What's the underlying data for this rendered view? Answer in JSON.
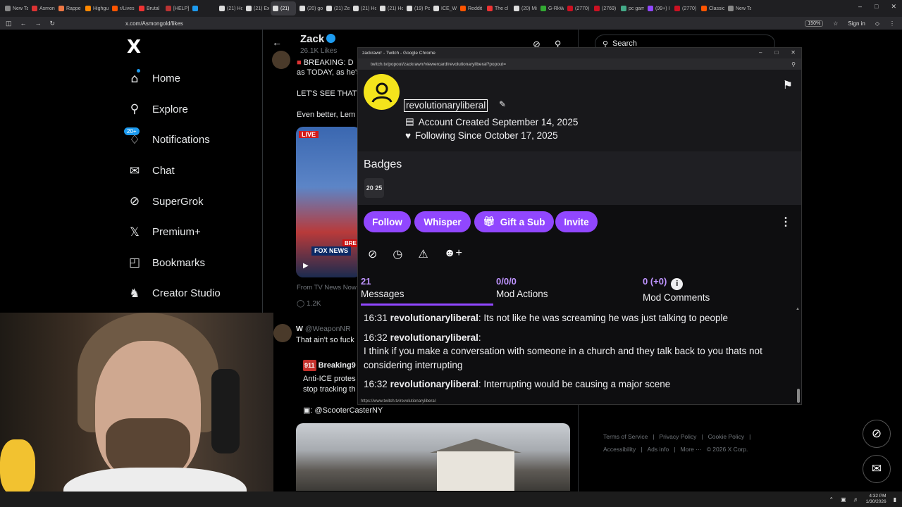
{
  "browser": {
    "tabs": [
      "New Tab",
      "Asmon",
      "Rappe",
      "Highgu",
      "r/Lives",
      "Brutal",
      "[HELP]",
      "",
      "(21) Ho",
      "(21) Ex",
      "(21)",
      "(20) go",
      "(21) Ze",
      "(21) Ho",
      "(21) Ho",
      "(19) Po",
      "ICE_Wi",
      "Reddit",
      "The cl",
      "(20) Mi",
      "G-RkWi",
      "(2770)",
      "(2769)",
      "pc gam",
      "(99+) I",
      "(2770)",
      "Classic",
      "New Ta"
    ],
    "url": "x.com/Asmongold/likes",
    "zoom": "150%",
    "sign_in": "Sign in"
  },
  "x_sidebar": {
    "logo": "X",
    "items": [
      {
        "label": "Home",
        "icon": "home-icon"
      },
      {
        "label": "Explore",
        "icon": "search-icon"
      },
      {
        "label": "Notifications",
        "icon": "bell-icon",
        "badge": "20+"
      },
      {
        "label": "Chat",
        "icon": "mail-icon"
      },
      {
        "label": "SuperGrok",
        "icon": "grok-icon"
      },
      {
        "label": "Premium+",
        "icon": "x-icon"
      },
      {
        "label": "Bookmarks",
        "icon": "bookmark-icon"
      },
      {
        "label": "Creator Studio",
        "icon": "creator-icon"
      }
    ]
  },
  "timeline": {
    "profile_name": "Zack",
    "likes": "26.1K Likes",
    "tweet1": {
      "line1": "BREAKING: D",
      "line2": "as TODAY, as he's",
      "line3": "LET'S SEE THAT I",
      "line4": "Even better, Lem",
      "live": "LIVE",
      "bre": "BRE",
      "fox": "FOX NEWS",
      "source": "From TV News Now",
      "replies": "1.2K"
    },
    "tweet2": {
      "author": "W",
      "handle": "@WeaponNR",
      "text": "That ain't so fuck",
      "quoted_name": "Breaking9",
      "quoted_line1": "Anti-ICE protes",
      "quoted_line2": "stop tracking th",
      "credit": ": @ScooterCasterNY",
      "badge911": "911"
    }
  },
  "right_column": {
    "search_placeholder": "Search",
    "footer": [
      "Terms of Service",
      "|",
      "Privacy Policy",
      "|",
      "Cookie Policy",
      "|",
      "Accessibility",
      "|",
      "Ads info",
      "|",
      "More ···",
      "© 2026 X Corp."
    ]
  },
  "popup": {
    "window_title": "zackrawrr - Twitch - Google Chrome",
    "url": "twitch.tv/popout/zackrawrr/viewercard/revolutionaryliberal?popout=",
    "username": "revolutionaryliberal",
    "account_created": "Account Created September 14, 2025",
    "following_since": "Following Since October 17, 2025",
    "badges_title": "Badges",
    "badge_text": "20 25",
    "buttons": {
      "follow": "Follow",
      "whisper": "Whisper",
      "gift": "Gift a Sub",
      "invite": "Invite"
    },
    "stats": {
      "messages_num": "21",
      "messages_lbl": "Messages",
      "mod_actions_num": "0/0/0",
      "mod_actions_lbl": "Mod Actions",
      "mod_comments_num": "0 (+0)",
      "mod_comments_lbl": "Mod Comments"
    },
    "chat": [
      {
        "time": "16:31",
        "name": "revolutionaryliberal",
        "text": "Its not like he was screaming he was just talking to people"
      },
      {
        "time": "16:32",
        "name": "revolutionaryliberal",
        "text": "I think if you make a conversation with someone in a church and they talk back to you thats not considering interrupting"
      },
      {
        "time": "16:32",
        "name": "revolutionaryliberal",
        "text": "Interrupting would be causing a major scene"
      }
    ],
    "status_url": "https://www.twitch.tv/revolutionaryliberal"
  },
  "taskbar": {
    "time": "4:32 PM",
    "date": "1/30/2026"
  },
  "colors": {
    "twitch_purple": "#9147ff",
    "x_blue": "#1d9bf0",
    "avatar_yellow": "#f4e41c"
  }
}
